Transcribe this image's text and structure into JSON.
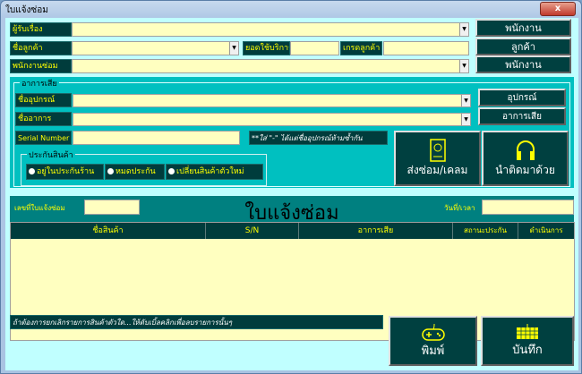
{
  "window": {
    "title": "ใบแจ้งซ่อม",
    "close": "x"
  },
  "top": {
    "receiver_label": "ผู้รับเรื่อง",
    "customer_label": "ชื่อลูกค้า",
    "usage_label": "ยอดใช้บริการ",
    "grade_label": "เกรดลูกค้า",
    "tech_label": "พนักงานซ่อม",
    "btn_employee1": "พนักงาน",
    "btn_customer": "ลูกค้า",
    "btn_employee2": "พนักงาน",
    "dropdown": "▼"
  },
  "fault": {
    "group_label": "อาการเสีย",
    "device_label": "ชื่ออุปกรณ์",
    "symptom_label": "ชื่ออาการ",
    "serial_label": "Serial Number",
    "note": "**ใส่ \"-\" ได้แต่ชื่ออุปกรณ์ห้ามซ้ำกัน",
    "btn_device": "อุปกรณ์",
    "btn_symptom": "อาการเสีย",
    "btn_send": "ส่งซ่อม/เคลม",
    "btn_bring": "นำติดมาด้วย",
    "warranty": {
      "label": "ประกันสินค้า",
      "options": [
        "อยู่ในประกันร้าน",
        "หมดประกัน",
        "เปลี่ยนสินค้าตัวใหม่"
      ]
    }
  },
  "header": {
    "number_label": "เลขที่ใบแจ้งซ่อม",
    "title": "ใบแจ้งซ่อม",
    "date_label": "วันที่/เวลา"
  },
  "table": {
    "columns": [
      "ชื่อสินค้า",
      "S/N",
      "อาการเสีย",
      "สถานะประกัน",
      "ดำเนินการ"
    ],
    "rows": []
  },
  "footer": {
    "hint": "ถ้าต้องการยกเลิกรายการสินค้าตัวใด...ให้ดับเบิ้ลคลิกเพื่อลบรายการนั้นๆ",
    "btn_print": "พิมพ์",
    "btn_save": "บันทึก"
  }
}
